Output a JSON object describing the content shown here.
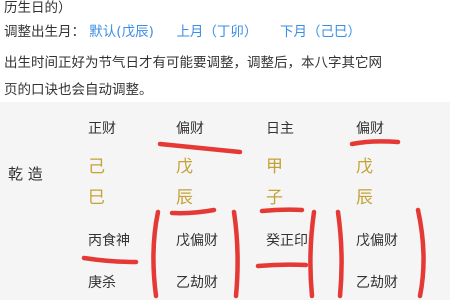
{
  "intro": {
    "line1": "历生日的）",
    "adjust_label": "调整出生月：",
    "default_link": "默认(戊辰)",
    "prev_link": "上月（丁卯）",
    "next_link": "下月（己巳）",
    "note_line1": "出生时间正好为节气日才有可能要调整，调整后，本八字其它网",
    "note_line2": "页的口诀也会自动调整。"
  },
  "bazi": {
    "row_label": "乾 造",
    "headers": [
      "正财",
      "偏财",
      "日主",
      "偏财"
    ],
    "stems": [
      "己",
      "戊",
      "甲",
      "戊"
    ],
    "branches": [
      "巳",
      "辰",
      "子",
      "辰"
    ],
    "hidden1": [
      "丙食神",
      "戊偏财",
      "癸正印",
      "戊偏财"
    ],
    "hidden2": [
      "庚杀",
      "乙劫财",
      "",
      "乙劫财"
    ]
  },
  "colors": {
    "link": "#3a8ee6",
    "gold": "#c4a235",
    "marker": "#e53935"
  }
}
